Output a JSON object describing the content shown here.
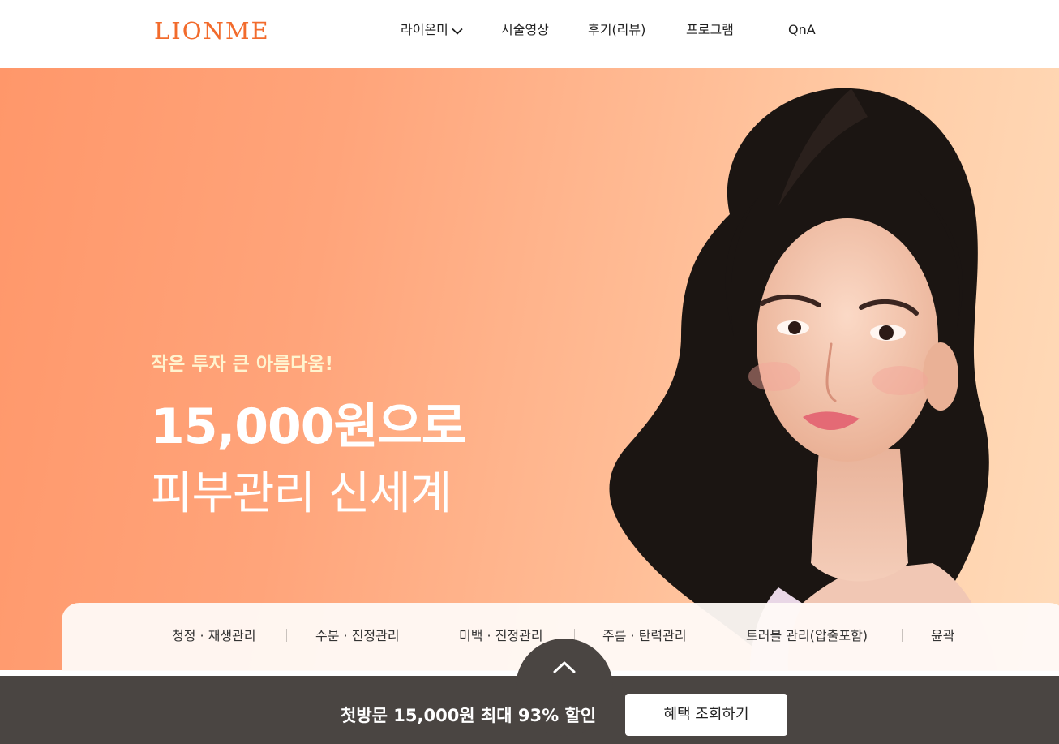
{
  "header": {
    "logo": "LIONME",
    "nav": [
      {
        "label": "라이온미"
      },
      {
        "label": "시술영상"
      },
      {
        "label": "후기(리뷰)"
      },
      {
        "label": "프로그램"
      },
      {
        "label": "QnA"
      }
    ]
  },
  "hero": {
    "tagline": "작은 투자 큰 아름다움!",
    "headline_line1": "15,000원으로",
    "headline_line2": "피부관리 신세계"
  },
  "categories": [
    {
      "label": "청정 · 재생관리"
    },
    {
      "label": "수분 · 진정관리"
    },
    {
      "label": "미백 · 진정관리"
    },
    {
      "label": "주름 · 탄력관리"
    },
    {
      "label": "트러블 관리(압출포함)"
    },
    {
      "label": "윤곽"
    }
  ],
  "promo_bar": {
    "text": "첫방문 15,000원 최대 93% 할인",
    "cta": "혜택 조회하기"
  },
  "colors": {
    "brand": "#f26b2c",
    "hero_gradient_start": "#ff976a",
    "hero_gradient_end": "#ffdbb9",
    "bottom_bar": "#4a4542"
  },
  "icons": {
    "dropdown": "chevron-down-icon",
    "scroll_top": "chevron-up-icon"
  }
}
